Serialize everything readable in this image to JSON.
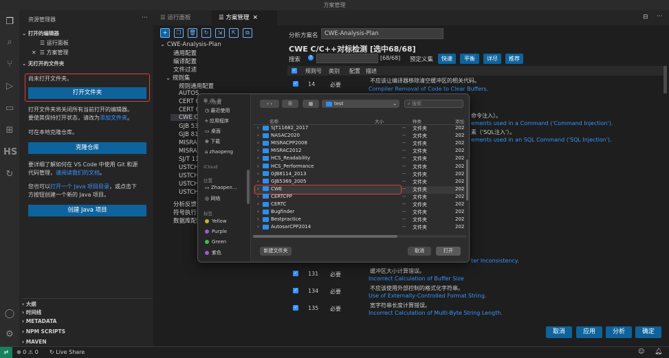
{
  "window": {
    "title": "方案管理"
  },
  "sidebar": {
    "title": "资源管理器",
    "more": "···",
    "open_editors": {
      "header": "打开的编辑器",
      "items": [
        {
          "label": "运行面板"
        },
        {
          "label": "方案管理",
          "close": "✕"
        }
      ]
    },
    "no_folder": {
      "header": "无打开的文件夹",
      "msg1": "尚未打开文件夹。",
      "open_folder_btn": "打开文件夹",
      "msg2a": "打开文件夹将关闭所有当前打开的编辑器。",
      "msg2b": "要使其保持打开状态，请改为",
      "msg2_link": "添加文件夹",
      "msg2_end": "。",
      "msg3": "可在本地克隆仓库。",
      "clone_btn": "克隆仓库",
      "msg4a": "要详细了解如何在 VS Code 中使用 Git 和源",
      "msg4b": "代码管理，",
      "msg4_link": "请阅读我们的文档",
      "msg4_end": "。",
      "msg5a": "您也可以",
      "msg5_link": "打开一个 Java 项目目录",
      "msg5_mid": "，或点击下",
      "msg5b": "方按钮创建一个新的 Java 项目。",
      "java_btn": "创建 Java 项目"
    },
    "bottom_sections": [
      "大纲",
      "时间线",
      "METADATA",
      "NPM SCRIPTS",
      "MAVEN"
    ]
  },
  "tabs": [
    {
      "label": "运行面板"
    },
    {
      "label": "方案管理",
      "close": "✕"
    }
  ],
  "editor_actions": [
    "⊟",
    "···"
  ],
  "tree": {
    "root": "CWE-Analysis-Plan",
    "items": [
      "通用配置",
      "编译配置",
      "文件过滤"
    ],
    "ruleset": "规则集",
    "rule_items": [
      "规则通用配置",
      "AUTOS",
      "CERT C",
      "CERT C",
      "CWE C",
      "GJB 53",
      "GJB 81",
      "MISRA",
      "MISRA",
      "SJ/T 11",
      "USTCH",
      "USTCH",
      "USTCH",
      "USTCH"
    ],
    "bottom_items": [
      "分析反馈",
      "符号执行",
      "数据库配置"
    ]
  },
  "plan": {
    "name_label": "分析方案名",
    "name_value": "CWE-Analysis-Plan",
    "title": "CWE C/C++对标检测 [选中68/68]",
    "search_label": "搜索",
    "search_count": "[68/68]",
    "preset_label": "预定义集",
    "presets": [
      "快速",
      "平衡",
      "详尽",
      "推荐"
    ],
    "headers": [
      "规则号",
      "类别",
      "配置",
      "描述"
    ],
    "rows": [
      {
        "id": "14",
        "cat": "必要",
        "cn": "不应该让编译器移除清空缓冲区的相关代码。",
        "en": "Compiler Removal of Code to Clear Buffers."
      },
      {
        "id": "131",
        "cat": "必要",
        "cn": "缓冲区大小计算错误。",
        "en": "Incorrect Calculation of Buffer Size"
      },
      {
        "id": "134",
        "cat": "必要",
        "cn": "不应该使用外部控制的格式化字符串。",
        "en": "Use of Externally-Controlled Format String."
      },
      {
        "id": "135",
        "cat": "必要",
        "cn": "宽字符串长度计算错误。",
        "en": "Incorrect Calculation of Multi-Byte String Length."
      }
    ],
    "partial_rows": [
      {
        "cn": "命令注入）。",
        "en": "ements used in a Command ('Command Injection')."
      },
      {
        "cn": "素（'SQL注入'）。",
        "en": "ements used in an SQL Command ('SQL Injection')."
      },
      {
        "en": "ter Inconsistency."
      }
    ],
    "buttons": [
      "取消",
      "应用",
      "分析",
      "确定"
    ]
  },
  "dialog": {
    "path": "test",
    "search_placeholder": "搜索",
    "side": {
      "personal_header": "个人收藏",
      "personal": [
        "最近使用",
        "应用程序",
        "桌面",
        "下载",
        "zhaopeng"
      ],
      "icloud_header": "iCloud",
      "location_header": "位置",
      "locations": [
        "Zhaopen...",
        "网络"
      ],
      "tags_header": "标签",
      "tags": [
        {
          "label": "Yellow",
          "color": "#c9b32e"
        },
        {
          "label": "Purple",
          "color": "#a358d6"
        },
        {
          "label": "Green",
          "color": "#3fbf4f"
        },
        {
          "label": "紫色",
          "color": "#a358d6"
        }
      ]
    },
    "columns": [
      "名称",
      "大小",
      "种类",
      "添加"
    ],
    "files": [
      {
        "name": "SJT11682_2017",
        "size": "--",
        "kind": "文件夹",
        "added": "202"
      },
      {
        "name": "NASAC2020",
        "size": "--",
        "kind": "文件夹",
        "added": "202"
      },
      {
        "name": "MISRACPP2008",
        "size": "--",
        "kind": "文件夹",
        "added": "202"
      },
      {
        "name": "MISRAC2012",
        "size": "--",
        "kind": "文件夹",
        "added": "202"
      },
      {
        "name": "HCS_Readability",
        "size": "--",
        "kind": "文件夹",
        "added": "202"
      },
      {
        "name": "HCS_Performance",
        "size": "--",
        "kind": "文件夹",
        "added": "202"
      },
      {
        "name": "GJB8114_2013",
        "size": "--",
        "kind": "文件夹",
        "added": "202"
      },
      {
        "name": "GJB5369_2005",
        "size": "--",
        "kind": "文件夹",
        "added": "202"
      },
      {
        "name": "CWE",
        "size": "--",
        "kind": "文件夹",
        "added": "202"
      },
      {
        "name": "CERTCPP",
        "size": "--",
        "kind": "文件夹",
        "added": "202"
      },
      {
        "name": "CERTC",
        "size": "--",
        "kind": "文件夹",
        "added": "202"
      },
      {
        "name": "Bugfinder",
        "size": "--",
        "kind": "文件夹",
        "added": "202"
      },
      {
        "name": "Bestpractice",
        "size": "--",
        "kind": "文件夹",
        "added": "202"
      },
      {
        "name": "AutosarCPP2014",
        "size": "--",
        "kind": "文件夹",
        "added": "202"
      }
    ],
    "new_folder": "新建文件夹",
    "cancel": "取消",
    "open": "打开"
  },
  "status": {
    "errors": "⊗ 0",
    "warnings": "⚠ 0",
    "live_share": "Live Share"
  }
}
